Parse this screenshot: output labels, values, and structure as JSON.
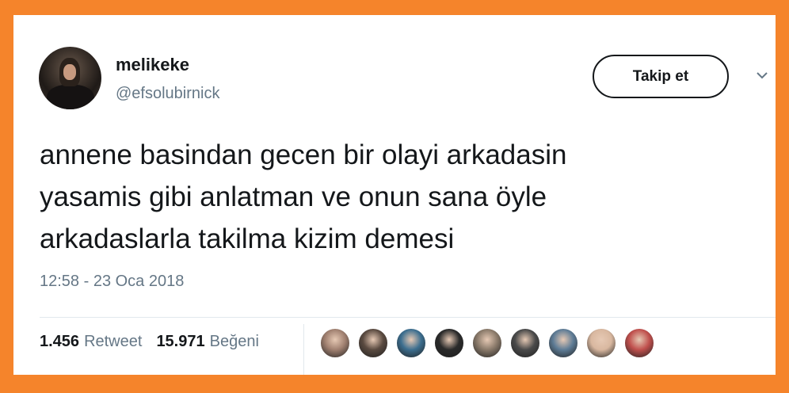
{
  "user": {
    "name": "melikeke",
    "handle": "@efsolubirnick",
    "avatar_icon": "profile-photo"
  },
  "follow_button": {
    "label": "Takip et"
  },
  "menu": {
    "icon": "chevron-down-icon"
  },
  "tweet": {
    "lines": [
      "annene basindan gecen bir olayi arkadasin",
      "yasamis gibi anlatman ve onun sana öyle",
      "arkadaslarla takilma kizim demesi"
    ],
    "timestamp": "12:58 - 23 Oca 2018"
  },
  "stats": {
    "retweet_count": "1.456",
    "retweet_label": "Retweet",
    "like_count": "15.971",
    "like_label": "Beğeni"
  },
  "likers": {
    "count_shown": 9,
    "colors": [
      "#a08070",
      "#5a4a40",
      "#3c6e8f",
      "#2a2a2a",
      "#8a7a6a",
      "#4a4a4a",
      "#5e7c96",
      "#d9b8a0",
      "#c0504d"
    ]
  },
  "colors": {
    "border": "#f5842b",
    "text_primary": "#14171a",
    "text_secondary": "#657786"
  }
}
